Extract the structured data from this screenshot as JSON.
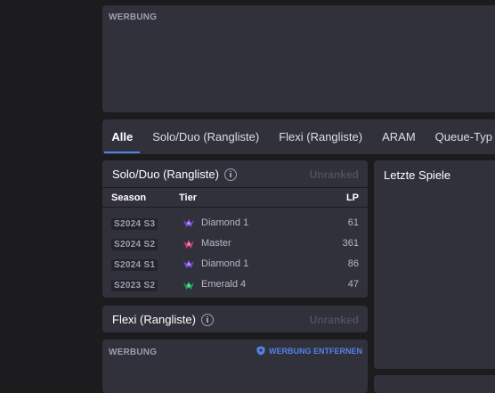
{
  "ad_top": {
    "label": "WERBUNG"
  },
  "tabs": [
    {
      "label": "Alle",
      "active": true
    },
    {
      "label": "Solo/Duo (Rangliste)",
      "active": false
    },
    {
      "label": "Flexi (Rangliste)",
      "active": false
    },
    {
      "label": "ARAM",
      "active": false
    },
    {
      "label": "Queue-Typ",
      "active": false
    }
  ],
  "solo": {
    "title": "Solo/Duo (Rangliste)",
    "status": "Unranked",
    "columns": {
      "season": "Season",
      "tier": "Tier",
      "lp": "LP"
    },
    "rows": [
      {
        "season": "S2024 S3",
        "tier": "Diamond 1",
        "lp": "61",
        "emblem": "diamond-emblem-icon",
        "color": "#7b4bd9"
      },
      {
        "season": "S2024 S2",
        "tier": "Master",
        "lp": "361",
        "emblem": "master-emblem-icon",
        "color": "#c0426e"
      },
      {
        "season": "S2024 S1",
        "tier": "Diamond 1",
        "lp": "86",
        "emblem": "diamond-emblem-icon",
        "color": "#7b4bd9"
      },
      {
        "season": "S2023 S2",
        "tier": "Emerald 4",
        "lp": "47",
        "emblem": "emerald-emblem-icon",
        "color": "#1fa35a"
      }
    ]
  },
  "flex": {
    "title": "Flexi (Rangliste)",
    "status": "Unranked"
  },
  "ad_bottom": {
    "label": "WERBUNG",
    "remove_label": "WERBUNG ENTFERNEN"
  },
  "recent": {
    "title": "Letzte Spiele"
  },
  "colors": {
    "accent": "#5383e8",
    "panel": "#31313c",
    "background": "#1c1c1f"
  }
}
